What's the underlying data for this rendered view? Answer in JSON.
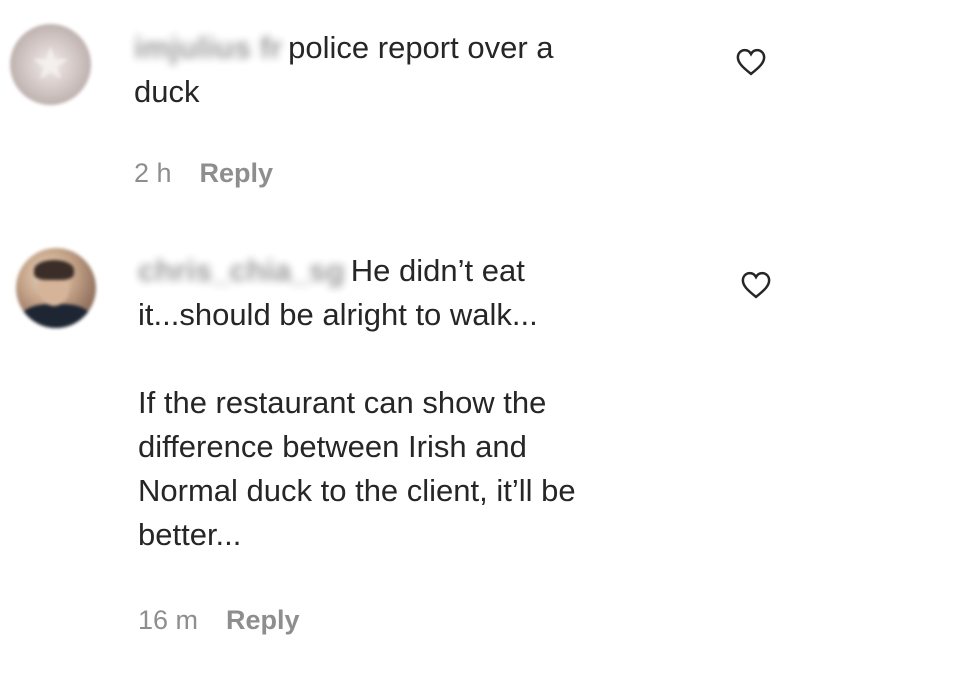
{
  "comments": [
    {
      "username": "imjulius fr",
      "text": "police report over a\nduck",
      "time": "2 h",
      "reply_label": "Reply",
      "like_icon": "heart-outline-icon"
    },
    {
      "username": "chris_chia_sg",
      "text": "He didn’t eat\nit...should be alright to walk...\n\nIf the restaurant can show the\ndifference between Irish and\nNormal duck to the client, it’ll be\nbetter...",
      "time": "16 m",
      "reply_label": "Reply",
      "like_icon": "heart-outline-icon"
    }
  ],
  "colors": {
    "text": "#262626",
    "secondary": "#8e8e8e",
    "background": "#ffffff"
  }
}
